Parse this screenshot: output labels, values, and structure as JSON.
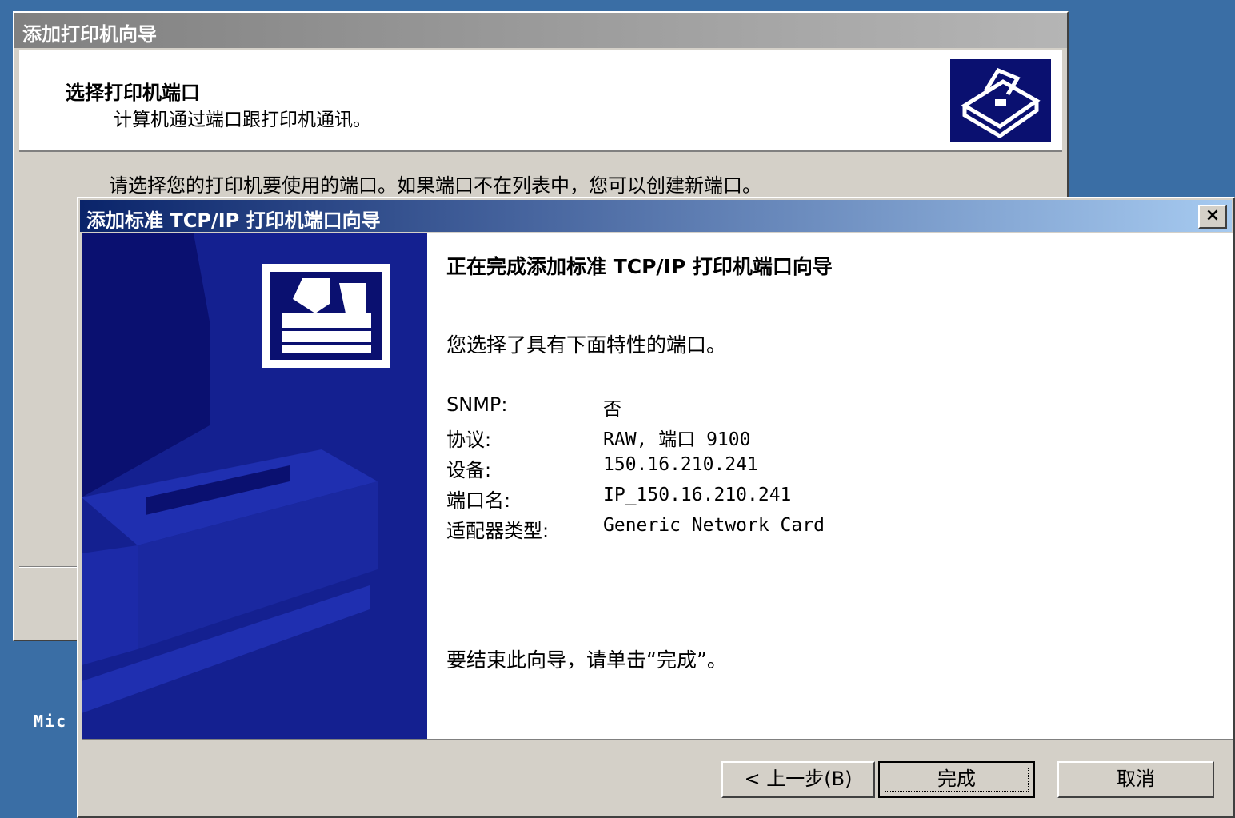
{
  "desktop": {
    "partial_text": "Mic"
  },
  "back_window": {
    "title": "添加打印机向导",
    "header_title": "选择打印机端口",
    "header_subtitle": "计算机通过端口跟打印机通讯。",
    "body_text": "请选择您的打印机要使用的端口。如果端口不在列表中，您可以创建新端口。",
    "icon": "printer-icon"
  },
  "dialog": {
    "title": "添加标准 TCP/IP 打印机端口向导",
    "close_label": "×",
    "heading": "正在完成添加标准 TCP/IP 打印机端口向导",
    "intro": "您选择了具有下面特性的端口。",
    "properties": [
      {
        "label": "SNMP:",
        "value": "否"
      },
      {
        "label": "协议:",
        "value": "RAW, 端口 9100"
      },
      {
        "label": "设备:",
        "value": "150.16.210.241"
      },
      {
        "label": "端口名:",
        "value": "IP_150.16.210.241"
      },
      {
        "label": "适配器类型:",
        "value": "Generic Network Card"
      }
    ],
    "finish_text": "要结束此向导，请单击“完成”。",
    "buttons": {
      "back": "< 上一步(B)",
      "finish": "完成",
      "cancel": "取消"
    },
    "art_icon": "printer-icon",
    "colors": {
      "title_start": "#0a246a",
      "art_background": "#0a1070",
      "face": "#d4d0c8"
    }
  }
}
